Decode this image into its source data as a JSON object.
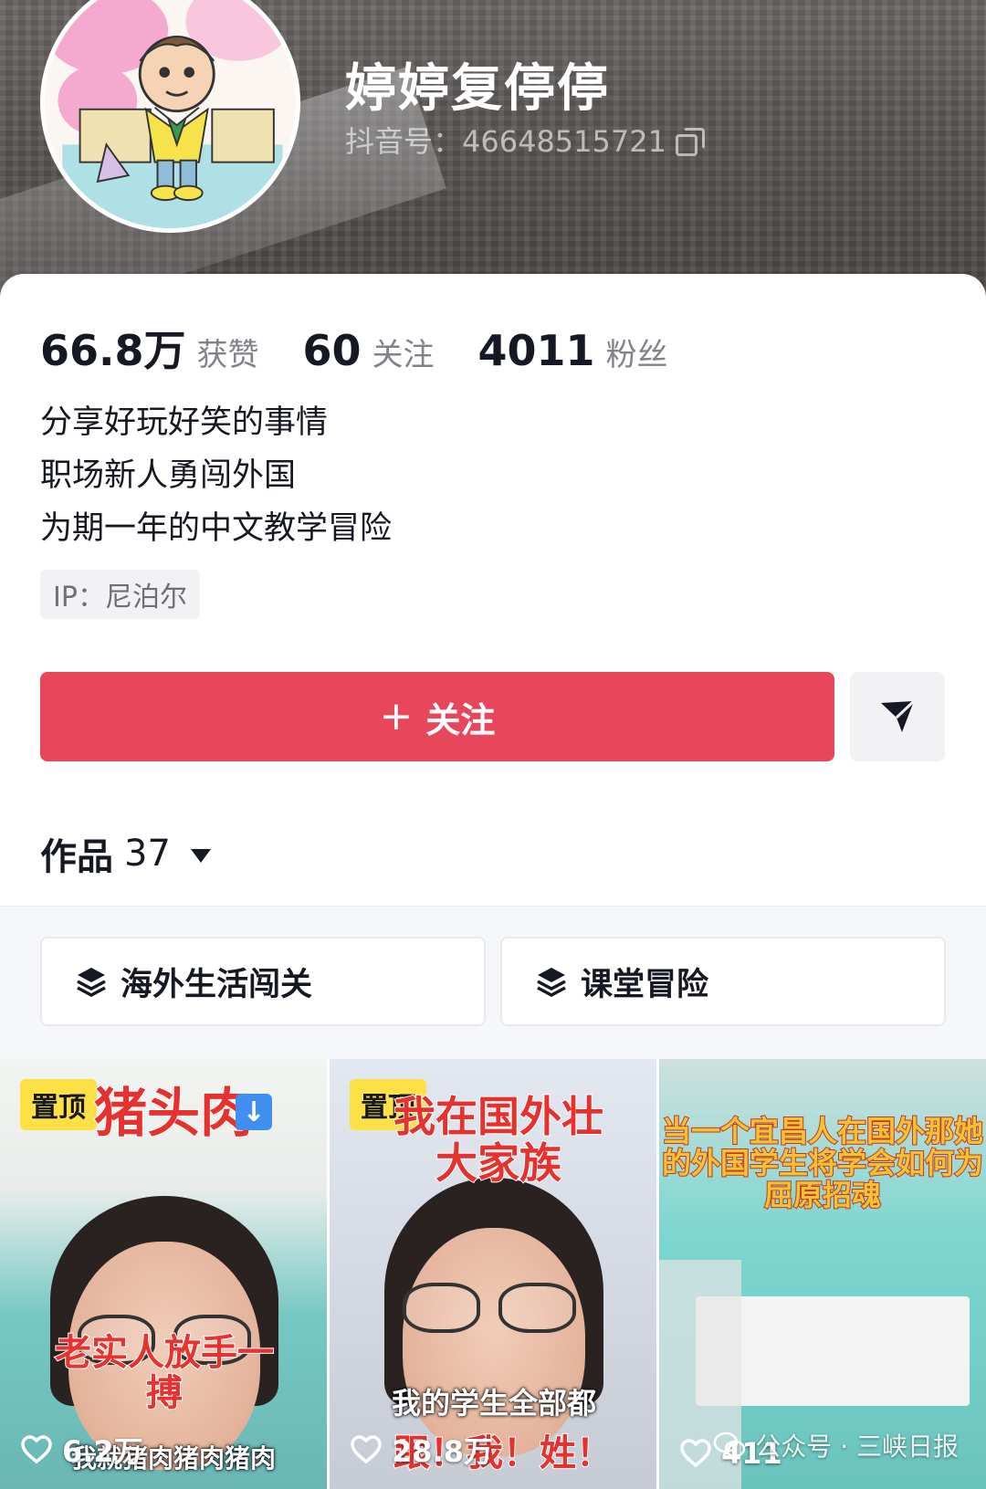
{
  "profile": {
    "nickname": "婷婷复停停",
    "douyin_id": "抖音号：46648515721",
    "stats": [
      {
        "num": "66.8万",
        "label": "获赞"
      },
      {
        "num": "60",
        "label": "关注"
      },
      {
        "num": "4011",
        "label": "粉丝"
      }
    ],
    "bio": [
      "分享好玩好笑的事情",
      "职场新人勇闯外国",
      "为期一年的中文教学冒险"
    ],
    "ip": "IP：尼泊尔"
  },
  "actions": {
    "follow_label": "关注",
    "follow_icon": "plus-icon",
    "send_icon": "send-icon",
    "accent_color": "#e8465a"
  },
  "works": {
    "label": "作品",
    "count": "37"
  },
  "collections": [
    {
      "label": "海外生活闯关",
      "icon": "layers-icon"
    },
    {
      "label": "课堂冒险",
      "icon": "layers-icon"
    }
  ],
  "videos": [
    {
      "pinned": "置顶",
      "title": "猪头肉",
      "overlay": "老实人放手一搏",
      "caption": "我就猪肉猪肉猪肉",
      "likes": "6.2万"
    },
    {
      "pinned": "置顶",
      "title": "我在国外壮大家族",
      "caption": "我的学生全部都",
      "caption2": "跟！我！姓！",
      "likes": "28.8万"
    },
    {
      "title": "当一个宜昌人在国外那她的外国学生将学会如何为屈原招魂",
      "likes": "411"
    }
  ],
  "watermark": "公众号 · 三峡日报"
}
